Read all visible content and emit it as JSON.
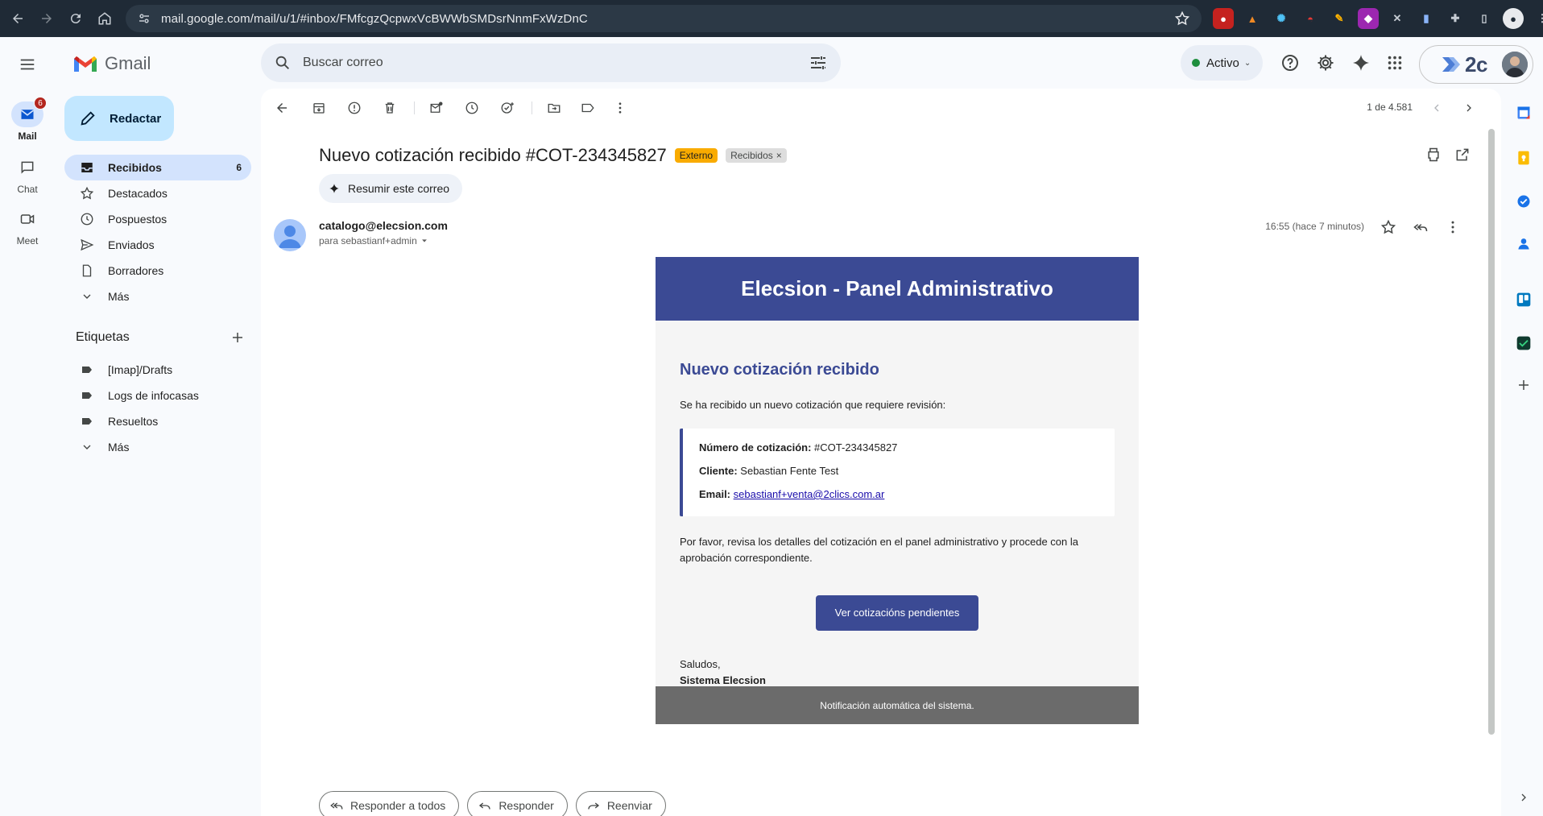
{
  "browser": {
    "url": "mail.google.com/mail/u/1/#inbox/FMfcgzQcpwxVcBWWbSMDsrNnmFxWzDnC"
  },
  "rail": {
    "items": [
      {
        "label": "Mail",
        "badge": "6"
      },
      {
        "label": "Chat"
      },
      {
        "label": "Meet"
      }
    ]
  },
  "app": {
    "name": "Gmail",
    "search_placeholder": "Buscar correo",
    "status": "Activo",
    "brand": "2c"
  },
  "sidebar": {
    "compose": "Redactar",
    "items": [
      {
        "label": "Recibidos",
        "count": "6"
      },
      {
        "label": "Destacados"
      },
      {
        "label": "Pospuestos"
      },
      {
        "label": "Enviados"
      },
      {
        "label": "Borradores"
      },
      {
        "label": "Más"
      }
    ],
    "labels_title": "Etiquetas",
    "labels": [
      {
        "label": "[Imap]/Drafts"
      },
      {
        "label": "Logs de infocasas"
      },
      {
        "label": "Resueltos"
      },
      {
        "label": "Más"
      }
    ]
  },
  "toolbar": {
    "pager": "1 de 4.581"
  },
  "message": {
    "subject": "Nuevo cotización recibido #COT-234345827",
    "chip_external": "Externo",
    "chip_inbox": "Recibidos",
    "summarize": "Resumir este correo",
    "from": "catalogo@elecsion.com",
    "to": "para sebastianf+admin",
    "time": "16:55 (hace 7 minutos)"
  },
  "email": {
    "header": "Elecsion - Panel Administrativo",
    "title": "Nuevo cotización recibido",
    "intro": "Se ha recibido un nuevo cotización que requiere revisión:",
    "quote_label": "Número de cotización:",
    "quote_value": "#COT-234345827",
    "client_label": "Cliente:",
    "client_value": "Sebastian Fente Test",
    "email_label": "Email:",
    "email_value": "sebastianf+venta@2clics.com.ar",
    "note": "Por favor, revisa los detalles del cotización en el panel administrativo y procede con la aprobación correspondiente.",
    "cta": "Ver cotizacións pendientes",
    "greeting": "Saludos,",
    "signature": "Sistema Elecsion",
    "footer": "Notificación automática del sistema."
  },
  "replies": {
    "reply_all": "Responder a todos",
    "reply": "Responder",
    "forward": "Reenviar"
  },
  "colors": {
    "brand_blue": "#3b4a94",
    "external_chip": "#f9ab00",
    "compose_bg": "#c2e7ff",
    "nav_active": "#d3e3fd"
  }
}
